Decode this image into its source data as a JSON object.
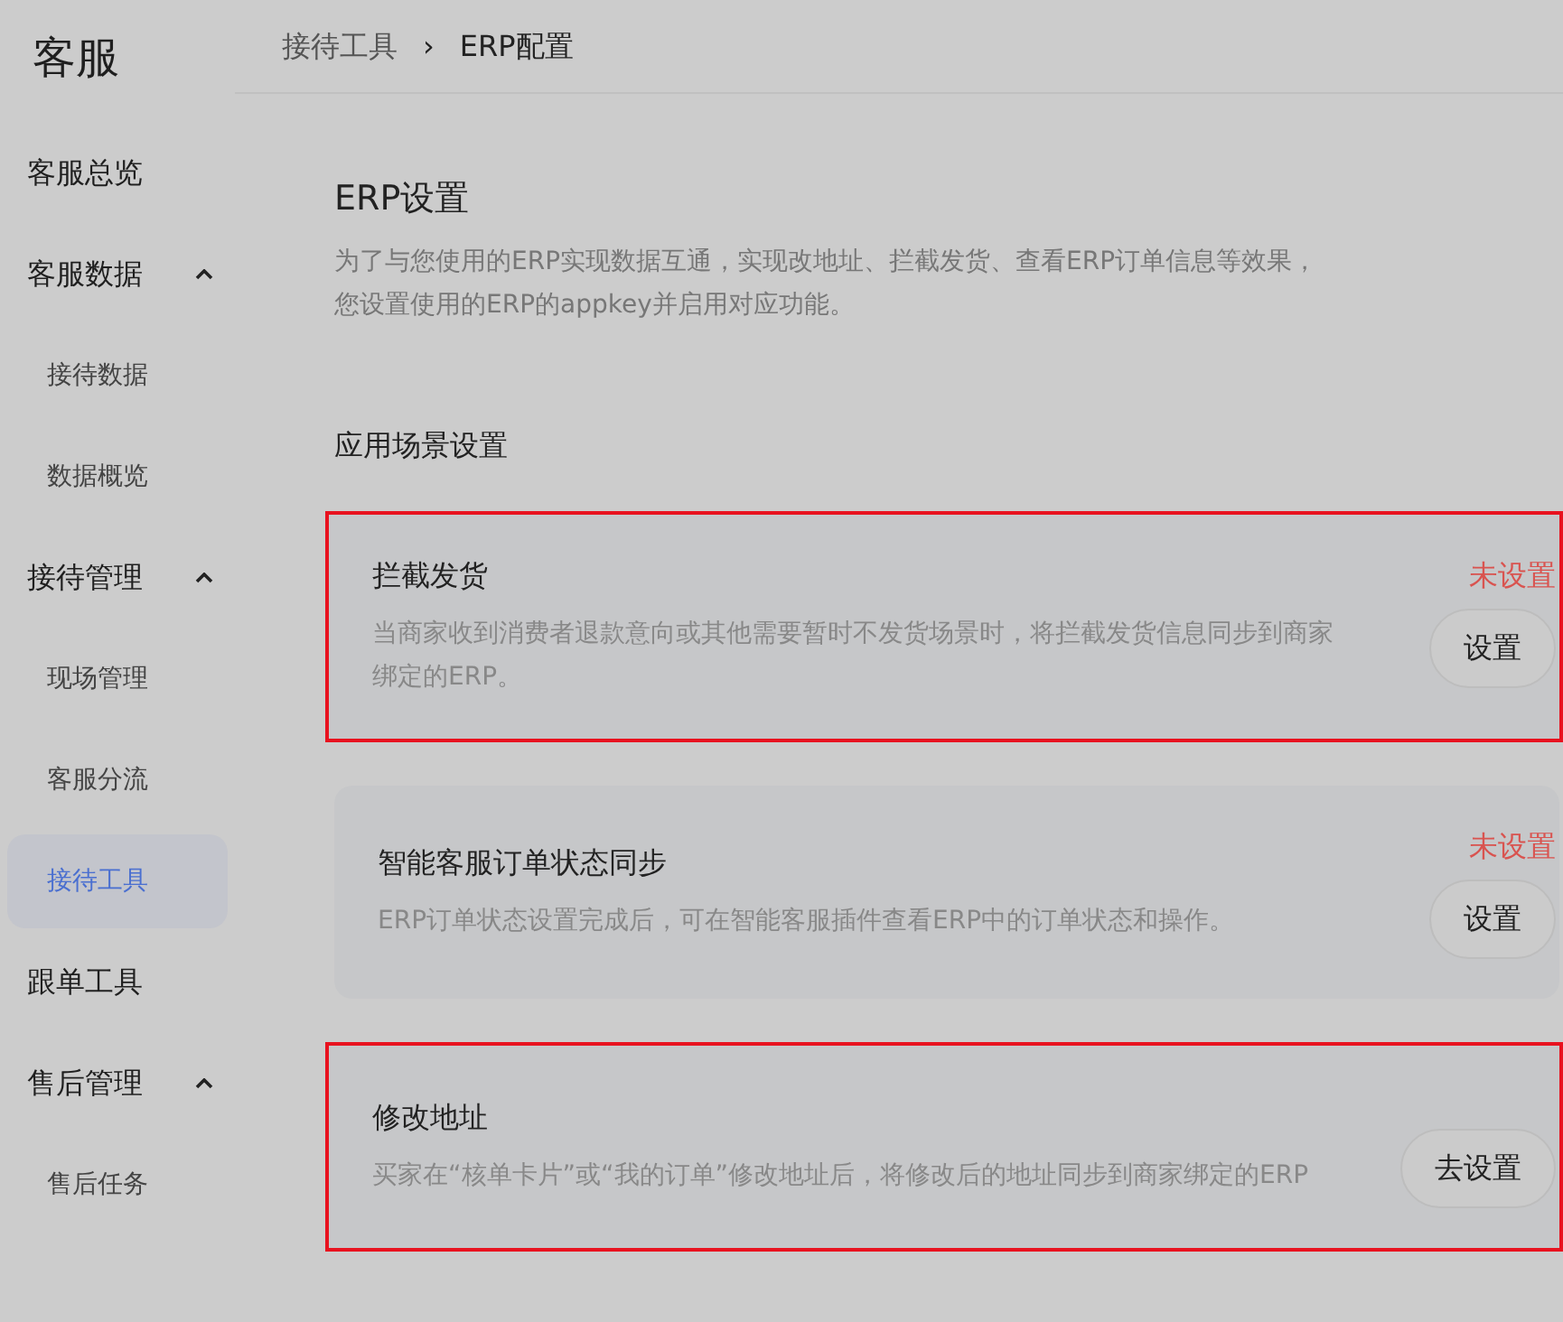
{
  "sidebar": {
    "title": "客服",
    "items": [
      {
        "label": "客服总览",
        "selected": false
      },
      {
        "label": "客服数据",
        "expanded": true,
        "selected": false,
        "children": [
          {
            "label": "接待数据",
            "selected": false
          },
          {
            "label": "数据概览",
            "selected": false
          }
        ]
      },
      {
        "label": "接待管理",
        "expanded": true,
        "selected": false,
        "children": [
          {
            "label": "现场管理",
            "selected": false
          },
          {
            "label": "客服分流",
            "selected": false
          },
          {
            "label": "接待工具",
            "selected": true
          }
        ]
      },
      {
        "label": "跟单工具",
        "selected": false
      },
      {
        "label": "售后管理",
        "expanded": true,
        "selected": false,
        "children": [
          {
            "label": "售后任务",
            "selected": false
          }
        ]
      }
    ]
  },
  "breadcrumb": [
    "接待工具",
    "›",
    "ERP配置"
  ],
  "section": {
    "title": "ERP设置",
    "description": "为了与您使用的ERP实现数据互通，实现改地址、拦截发货、查看ERP订单信息等效果，",
    "description_line2": "您设置使用的ERP的appkey并启用对应功能。"
  },
  "scenes": {
    "title": "应用场景设置",
    "cards": [
      {
        "title": "拦截发货",
        "description": "当商家收到消费者退款意向或其他需要暂时不发货场景时，将拦截发货信息同步到商家绑定的ERP。",
        "status": "未设置",
        "button": "设置",
        "highlighted": true
      },
      {
        "title": "智能客服订单状态同步",
        "description": "ERP订单状态设置完成后，可在智能客服插件查看ERP中的订单状态和操作。",
        "status": "未设置",
        "button": "设置",
        "highlighted": false
      },
      {
        "title": "修改地址",
        "description": "买家在“核单卡片”或“我的订单”修改地址后，将修改后的地址同步到商家绑定的ERP",
        "button": "去设置",
        "highlighted": true
      }
    ]
  }
}
